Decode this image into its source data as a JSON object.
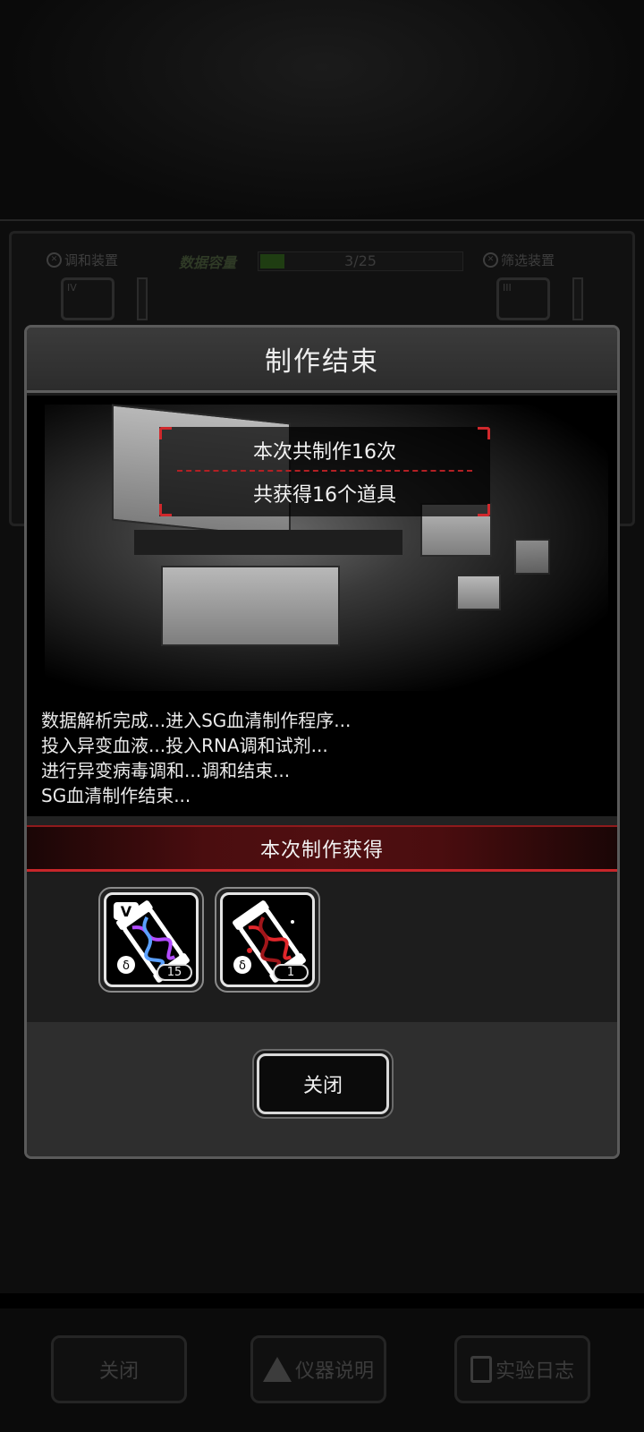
{
  "background": {
    "left_device_label": "调和装置",
    "right_device_label": "筛选装置",
    "capacity_label": "数据容量",
    "capacity_value": "3/25",
    "capacity_progress": 0.12,
    "left_machine_tag": "IV",
    "right_machine_tag": "III",
    "footer_buttons": [
      "关闭",
      "仪器说明",
      "实验日志"
    ]
  },
  "dialog": {
    "title": "制作结束",
    "stats": {
      "total_made": "本次共制作16次",
      "total_items": "共获得16个道具"
    },
    "log_lines": [
      "数据解析完成...进入SG血清制作程序...",
      "投入异变血液...投入RNA调和试剂...",
      "进行异变病毒调和...调和结束...",
      "SG血清制作结束..."
    ],
    "rewards_title": "本次制作获得",
    "items": [
      {
        "icon": "serum-v-icon",
        "tag": "V",
        "count": "15",
        "accent": "#b34cff"
      },
      {
        "icon": "serum-red-icon",
        "tag": "",
        "count": "1",
        "accent": "#e0262b"
      }
    ],
    "close_label": "关闭"
  },
  "colors": {
    "accent_red": "#d0282c",
    "panel_border": "#5a5a5a"
  }
}
